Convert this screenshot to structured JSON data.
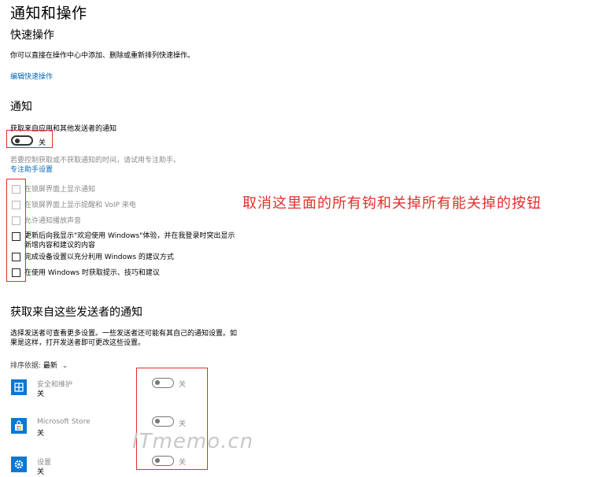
{
  "page_title": "通知和操作",
  "quick_actions": {
    "heading": "快速操作",
    "desc": "你可以直接在操作中心中添加、删除或重新排列快速操作。",
    "edit_link": "编辑快速操作"
  },
  "notifications": {
    "heading": "通知",
    "toggle_label": "获取来自应用和其他发送者的通知",
    "toggle_state": "关",
    "focus_hint": "若要控制获取或不获取通知的时间，请试用专注助手。",
    "focus_link": "专注助手设置",
    "checkboxes": [
      {
        "label": "在锁屏界面上显示通知",
        "disabled": true
      },
      {
        "label": "在锁屏界面上显示提醒和 VoIP 来电",
        "disabled": true
      },
      {
        "label": "允许通知播放声音",
        "disabled": true
      },
      {
        "label_line1": "更新后向我显示\"欢迎使用 Windows\"体验，并在我登录时突出显示",
        "label_line2": "新增内容和建议的内容",
        "disabled": false
      },
      {
        "label": "完成设备设置以充分利用 Windows 的建议方式",
        "disabled": false
      },
      {
        "label": "在使用 Windows 时获取提示、技巧和建议",
        "disabled": false
      }
    ]
  },
  "senders": {
    "heading": "获取来自这些发送者的通知",
    "desc_line1": "选择发送者可查看更多设置。一些发送者还可能有其自己的通知设置。如",
    "desc_line2": "果是这样，打开发送者即可更改这些设置。",
    "sort_label": "排序依据: ",
    "sort_value": "最新",
    "apps": [
      {
        "name": "安全和维护",
        "status": "关",
        "toggle_state": "关",
        "icon": "security-maintenance-icon"
      },
      {
        "name": "Microsoft Store",
        "status": "关",
        "toggle_state": "关",
        "icon": "store-bag-icon"
      },
      {
        "name": "设置",
        "status": "关",
        "toggle_state": "关",
        "icon": "gear-icon"
      }
    ]
  },
  "annotation": "取消这里面的所有钩和关掉所有能关掉的按钮",
  "watermark": "ITmemo.cn",
  "colors": {
    "accent": "#0a78d4",
    "link": "#0067b8",
    "annotation_red": "#e0302a"
  }
}
